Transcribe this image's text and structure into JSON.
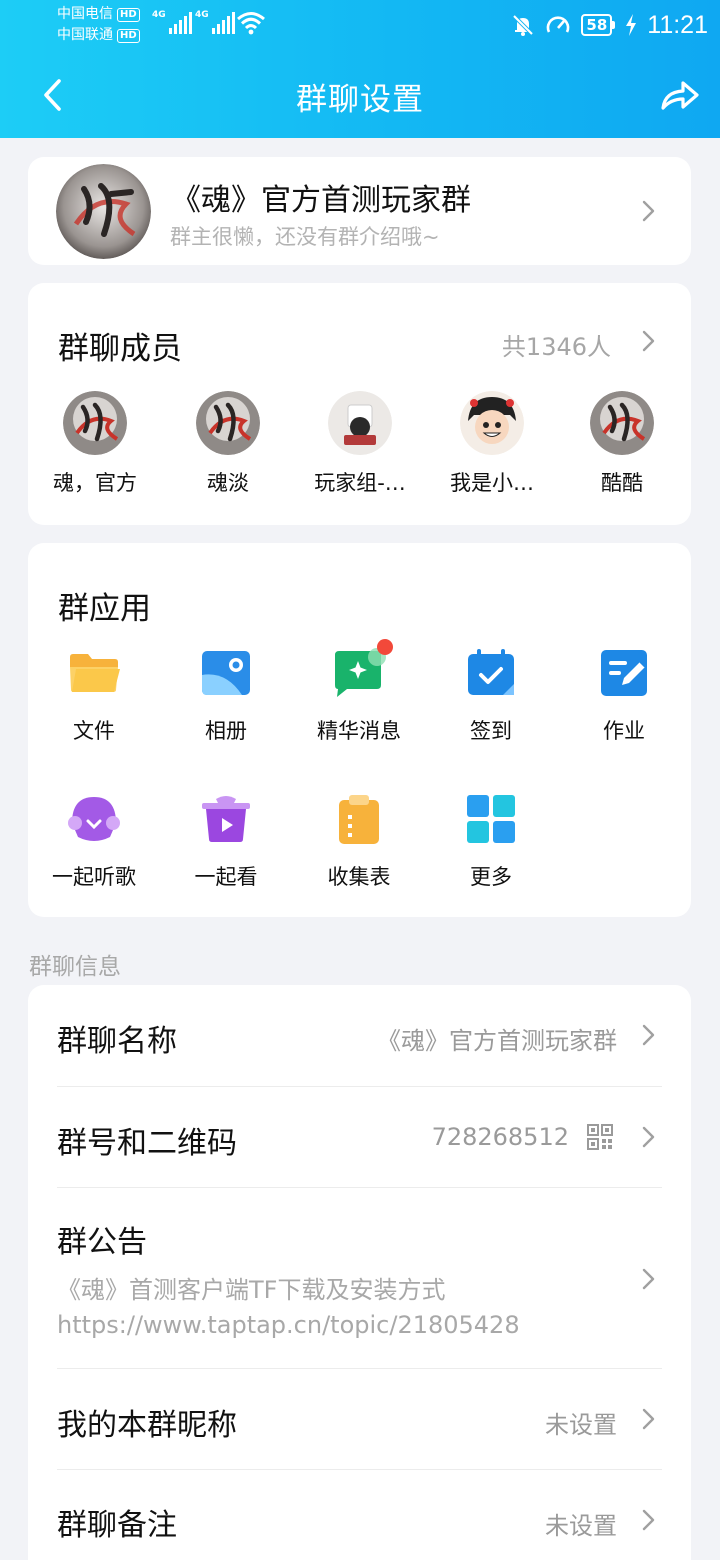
{
  "status_bar": {
    "carrier1": "中国电信",
    "carrier2": "中国联通",
    "hd": "HD",
    "net1": "4G",
    "net2": "4G",
    "battery": "58",
    "time": "11:21"
  },
  "nav": {
    "title": "群聊设置",
    "back_icon": "chevron-left-icon",
    "share_icon": "share-icon"
  },
  "group": {
    "name": "《魂》官方首测玩家群",
    "description": "群主很懒，还没有群介绍哦~"
  },
  "members": {
    "title": "群聊成员",
    "count": "共1346人",
    "list": [
      {
        "name": "魂，官方"
      },
      {
        "name": "魂淡"
      },
      {
        "name": "玩家组-…"
      },
      {
        "name": "我是小…"
      },
      {
        "name": "酷酷"
      }
    ]
  },
  "apps": {
    "title": "群应用",
    "items": [
      {
        "label": "文件",
        "icon": "folder-icon"
      },
      {
        "label": "相册",
        "icon": "album-icon"
      },
      {
        "label": "精华消息",
        "icon": "essence-message-icon"
      },
      {
        "label": "签到",
        "icon": "checkin-calendar-icon"
      },
      {
        "label": "作业",
        "icon": "homework-icon"
      },
      {
        "label": "一起听歌",
        "icon": "listen-together-icon"
      },
      {
        "label": "一起看",
        "icon": "watch-together-icon"
      },
      {
        "label": "收集表",
        "icon": "form-clipboard-icon"
      },
      {
        "label": "更多",
        "icon": "more-grid-icon"
      }
    ]
  },
  "info": {
    "section_label": "群聊信息",
    "group_name_label": "群聊名称",
    "group_name_value": "《魂》官方首测玩家群",
    "group_number_label": "群号和二维码",
    "group_number_value": "728268512",
    "notice_label": "群公告",
    "notice_line1": "《魂》首测客户端TF下载及安装方式",
    "notice_line2": "https://www.taptap.cn/topic/21805428",
    "nickname_label": "我的本群昵称",
    "nickname_value": "未设置",
    "remark_label": "群聊备注",
    "remark_value": "未设置"
  },
  "colors": {
    "header_start": "#1dcdf6",
    "header_end": "#0fa8f2",
    "page_bg": "#f2f3f7",
    "secondary_text": "#a8a8a8"
  }
}
